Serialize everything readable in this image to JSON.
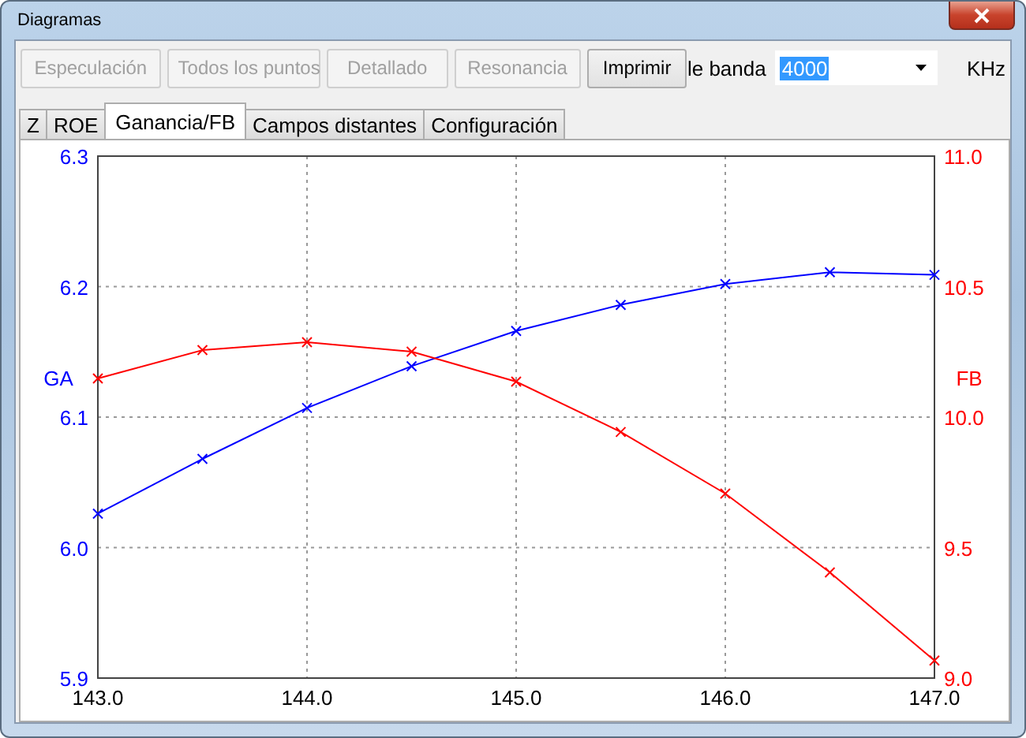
{
  "window": {
    "title": "Diagramas"
  },
  "toolbar": {
    "buttons": [
      {
        "label": "Especulación",
        "disabled": true
      },
      {
        "label": "Todos los puntos",
        "disabled": true
      },
      {
        "label": "Detallado",
        "disabled": true
      },
      {
        "label": "Resonancia",
        "disabled": true
      },
      {
        "label": "Imprimir",
        "disabled": false
      }
    ],
    "bandwidth": {
      "label": "le banda",
      "value": "4000",
      "unit": "KHz"
    }
  },
  "tabs": [
    {
      "label": "Z",
      "selected": false
    },
    {
      "label": "ROE",
      "selected": false
    },
    {
      "label": "Ganancia/FB",
      "selected": true
    },
    {
      "label": "Campos distantes",
      "selected": false
    },
    {
      "label": "Configuración",
      "selected": false
    }
  ],
  "chart": {
    "chart_data": {
      "type": "line",
      "grid": true,
      "x": [
        143.0,
        143.5,
        144.0,
        144.5,
        145.0,
        145.5,
        146.0,
        146.5,
        147.0
      ],
      "xlim": [
        143,
        147
      ],
      "ylim": [
        5.9,
        6.3
      ],
      "y2lim": [
        9.0,
        11.0
      ],
      "xticks": [
        {
          "value": 143,
          "label": "143.0"
        },
        {
          "value": 144,
          "label": "144.0"
        },
        {
          "value": 145,
          "label": "145.0"
        },
        {
          "value": 146,
          "label": "146.0"
        },
        {
          "value": 147,
          "label": "147.0"
        }
      ],
      "yticks": [
        {
          "value": 5.9,
          "label": "5.9"
        },
        {
          "value": 6.0,
          "label": "6.0"
        },
        {
          "value": 6.1,
          "label": "6.1"
        },
        {
          "value": 6.2,
          "label": "6.2"
        },
        {
          "value": 6.3,
          "label": "6.3"
        }
      ],
      "y2ticks": [
        {
          "value": 9.0,
          "label": "9.0"
        },
        {
          "value": 9.5,
          "label": "9.5"
        },
        {
          "value": 10.0,
          "label": "10.0"
        },
        {
          "value": 10.5,
          "label": "10.5"
        },
        {
          "value": 11.0,
          "label": "11.0"
        }
      ],
      "series": [
        {
          "name": "GA",
          "color": "#0000ff",
          "marker": "x",
          "values": [
            6.026,
            6.068,
            6.107,
            6.139,
            6.166,
            6.186,
            6.202,
            6.211,
            6.209
          ]
        },
        {
          "name": "FB",
          "color": "#ff0000",
          "axis": "y2",
          "marker": "x",
          "values": [
            10.148,
            10.257,
            10.287,
            10.251,
            10.136,
            9.943,
            9.707,
            9.405,
            9.067
          ]
        }
      ]
    }
  }
}
